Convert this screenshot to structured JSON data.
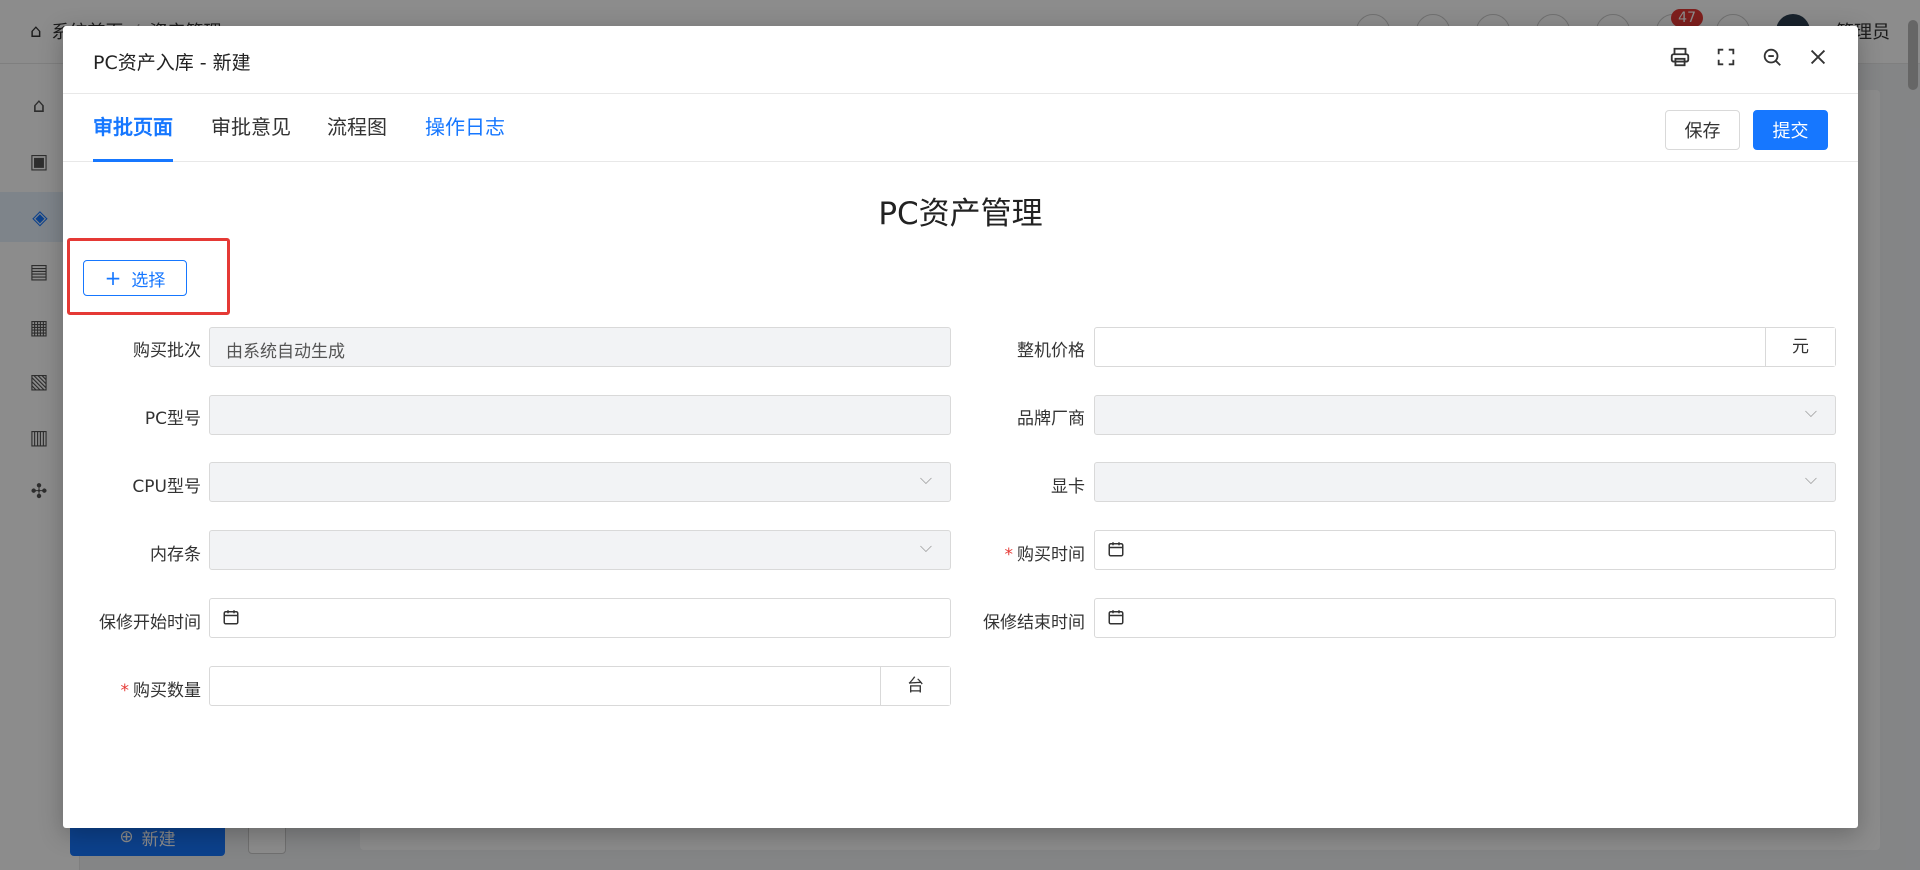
{
  "background": {
    "breadcrumb": [
      "系统首页",
      "资产管理"
    ],
    "badge_count": "47",
    "user_name": "管理员",
    "new_button_label": "新建"
  },
  "modal": {
    "title": "PC资产入库 - 新建",
    "tools": [
      "printer-icon",
      "fullscreen-icon",
      "zoom-icon",
      "close-icon"
    ]
  },
  "tabs": [
    {
      "label": "审批页面",
      "active": true
    },
    {
      "label": "审批意见",
      "active": false
    },
    {
      "label": "流程图",
      "active": false
    },
    {
      "label": "操作日志",
      "active": false
    }
  ],
  "actions": {
    "save": "保存",
    "submit": "提交"
  },
  "form": {
    "title": "PC资产管理",
    "select_button": "选择",
    "fields": {
      "batch": {
        "label": "购买批次",
        "placeholder": "由系统自动生成"
      },
      "price": {
        "label": "整机价格",
        "unit": "元"
      },
      "pc_model": {
        "label": "PC型号"
      },
      "brand": {
        "label": "品牌厂商"
      },
      "cpu": {
        "label": "CPU型号"
      },
      "gpu": {
        "label": "显卡"
      },
      "memory": {
        "label": "内存条"
      },
      "purchase_time": {
        "label": "购买时间",
        "required": true
      },
      "warranty_start": {
        "label": "保修开始时间"
      },
      "warranty_end": {
        "label": "保修结束时间"
      },
      "quantity": {
        "label": "购买数量",
        "unit": "台",
        "required": true
      }
    }
  },
  "colors": {
    "accent": "#1677ff",
    "required": "#e53935",
    "highlight": "#e53935"
  }
}
